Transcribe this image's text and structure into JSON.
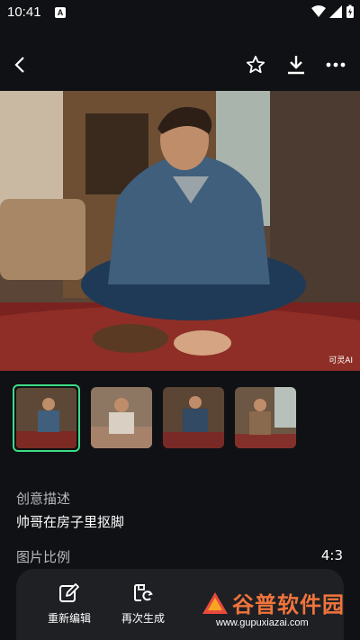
{
  "status_bar": {
    "time": "10:41",
    "badge": "A"
  },
  "image": {
    "watermark": "可灵AI"
  },
  "description": {
    "label": "创意描述",
    "text": "帅哥在房子里抠脚"
  },
  "ratio": {
    "label": "图片比例",
    "value": "4:3"
  },
  "actions": [
    {
      "label": "重新编辑",
      "icon": "edit-icon"
    },
    {
      "label": "再次生成",
      "icon": "regenerate-icon"
    }
  ],
  "site_watermark": {
    "brand": "谷普软件园",
    "url": "www.gupuxiazai.com"
  },
  "colors": {
    "background": "#101114",
    "accent": "#3ddc84",
    "bar": "#1f2024"
  }
}
